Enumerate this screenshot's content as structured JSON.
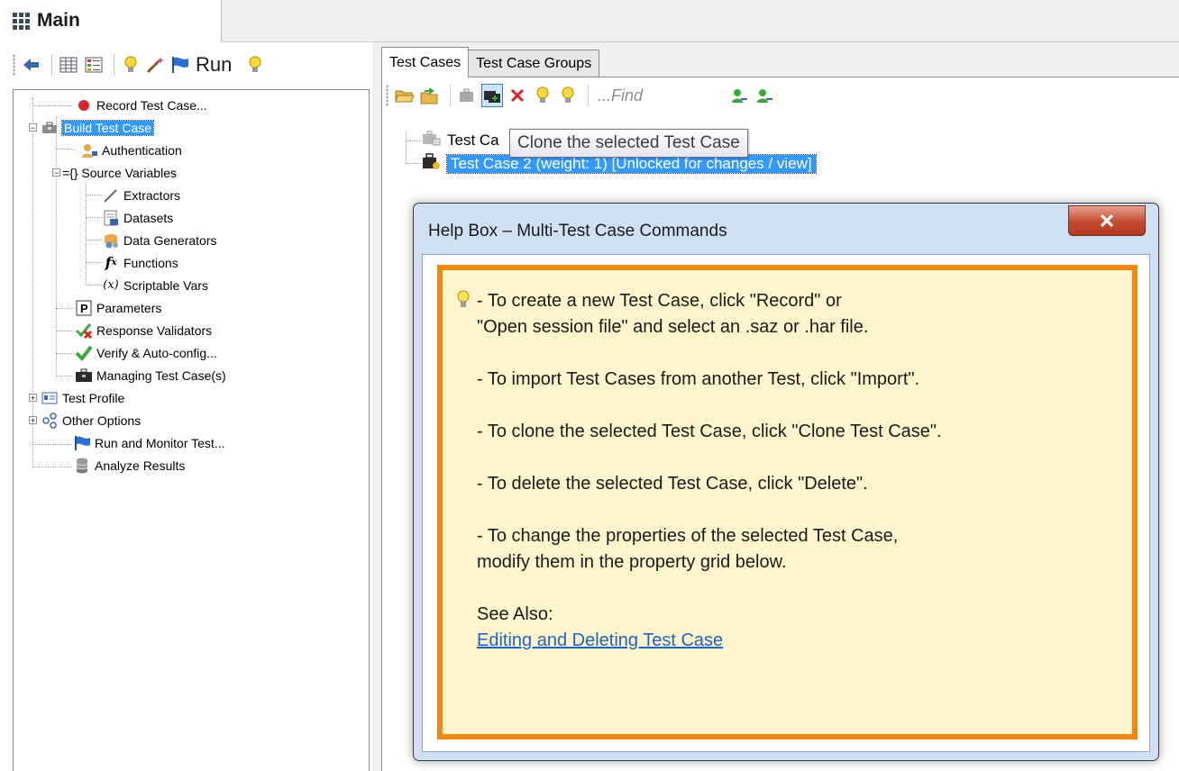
{
  "main_tab": {
    "title": "Main"
  },
  "left_toolbar": {
    "run_label": "Run"
  },
  "tree": {
    "items": [
      {
        "label": "Record Test Case..."
      },
      {
        "label": "Build Test Case"
      },
      {
        "label": "Authentication"
      },
      {
        "label": "={} Source Variables"
      },
      {
        "label": "Extractors"
      },
      {
        "label": "Datasets"
      },
      {
        "label": "Data Generators"
      },
      {
        "label": "Functions"
      },
      {
        "label": "Scriptable Vars"
      },
      {
        "label": "Parameters"
      },
      {
        "label": "Response Validators"
      },
      {
        "label": "Verify & Auto-config..."
      },
      {
        "label": "Managing Test Case(s)"
      },
      {
        "label": "Test Profile"
      },
      {
        "label": "Other Options"
      },
      {
        "label": "Run and Monitor Test..."
      },
      {
        "label": "Analyze Results"
      }
    ]
  },
  "right": {
    "tabs": [
      {
        "label": "Test Cases"
      },
      {
        "label": "Test Case Groups"
      }
    ],
    "find_placeholder": "...Find",
    "test_cases": [
      {
        "label": "Test Ca"
      },
      {
        "label": "Test Case 2 (weight: 1) [Unlocked for changes / view]"
      }
    ],
    "tooltip": "Clone the selected Test Case"
  },
  "help_dialog": {
    "title": "Help Box – Multi-Test Case Commands",
    "close_label": "X",
    "lines": [
      "- To create a new Test Case, click \"Record\" or",
      "\"Open session file\" and select an .saz or .har file.",
      "- To import Test Cases from another Test, click \"Import\".",
      "- To clone the selected Test Case, click \"Clone Test Case\".",
      "- To delete the selected Test Case, click \"Delete\".",
      "- To change the properties of the selected Test Case,",
      "modify them in the property grid below.",
      "See Also:"
    ],
    "link": "Editing and Deleting Test Case"
  },
  "colors": {
    "selection": "#3399ff",
    "help_border": "#f0870f",
    "help_background": "#fff5cc",
    "link": "#1e63c4",
    "close_button": "#c44a2f"
  }
}
